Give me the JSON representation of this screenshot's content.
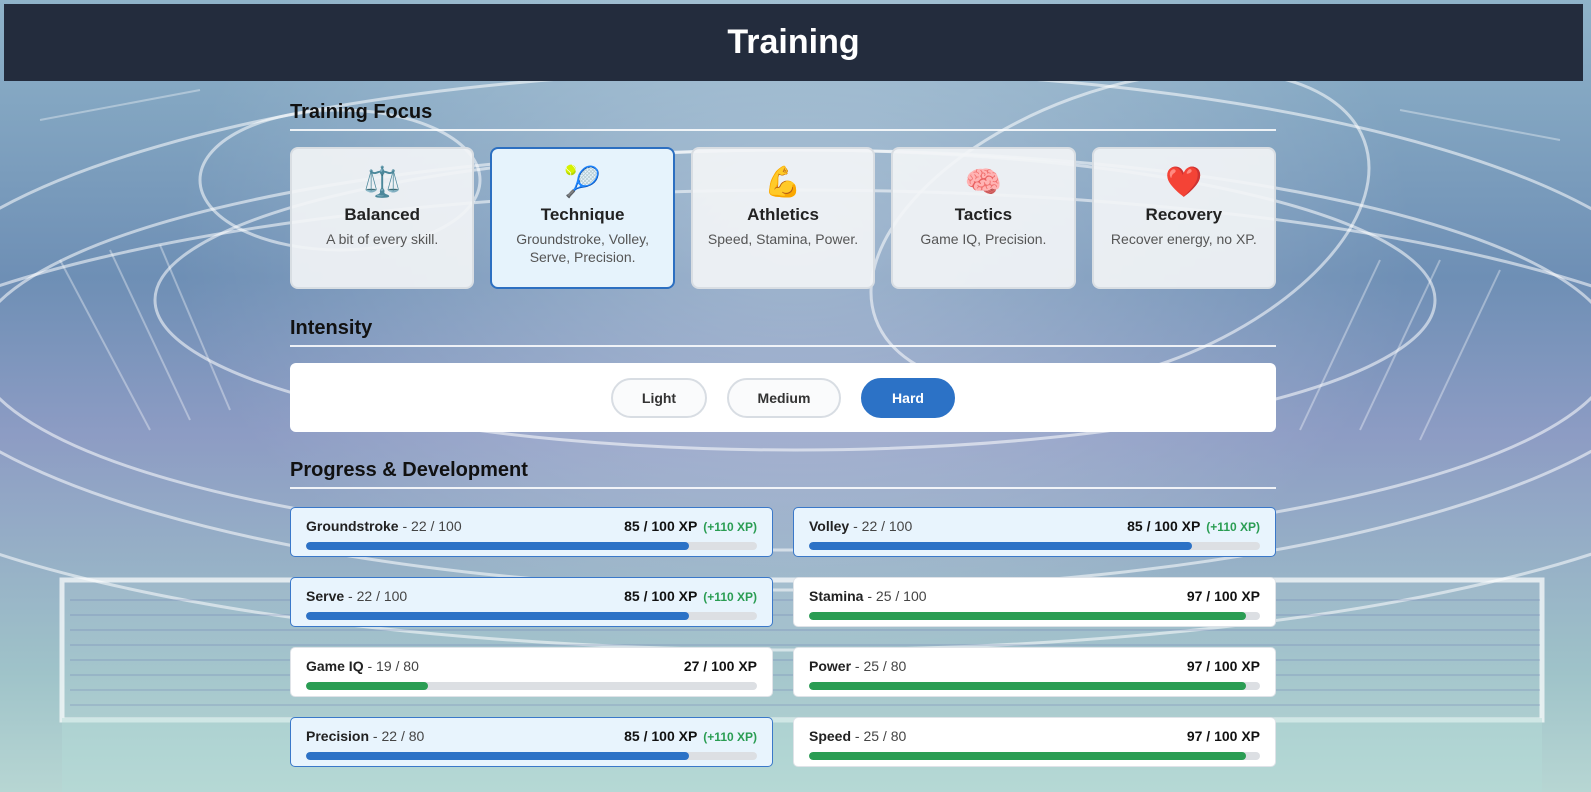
{
  "header": {
    "title": "Training"
  },
  "focus": {
    "title": "Training Focus",
    "cards": [
      {
        "icon": "⚖️",
        "icon_name": "scales-icon",
        "name": "Balanced",
        "desc": "A bit of every skill.",
        "selected": false
      },
      {
        "icon": "🎾",
        "icon_name": "tennis-ball-icon",
        "name": "Technique",
        "desc": "Groundstroke, Volley, Serve, Precision.",
        "selected": true
      },
      {
        "icon": "💪",
        "icon_name": "flexed-bicep-icon",
        "name": "Athletics",
        "desc": "Speed, Stamina, Power.",
        "selected": false
      },
      {
        "icon": "🧠",
        "icon_name": "brain-icon",
        "name": "Tactics",
        "desc": "Game IQ, Precision.",
        "selected": false
      },
      {
        "icon": "❤️",
        "icon_name": "heart-icon",
        "name": "Recovery",
        "desc": "Recover energy, no XP.",
        "selected": false
      }
    ]
  },
  "intensity": {
    "title": "Intensity",
    "options": [
      "Light",
      "Medium",
      "Hard"
    ],
    "selected": "Hard"
  },
  "progress": {
    "title": "Progress & Development",
    "stats": [
      {
        "name": "Groundstroke",
        "level": "22 / 100",
        "xp": "85 / 100 XP",
        "gain": "(+110 XP)",
        "fill": 0.85,
        "color": "blue",
        "boosted": true
      },
      {
        "name": "Volley",
        "level": "22 / 100",
        "xp": "85 / 100 XP",
        "gain": "(+110 XP)",
        "fill": 0.85,
        "color": "blue",
        "boosted": true
      },
      {
        "name": "Serve",
        "level": "22 / 100",
        "xp": "85 / 100 XP",
        "gain": "(+110 XP)",
        "fill": 0.85,
        "color": "blue",
        "boosted": true
      },
      {
        "name": "Stamina",
        "level": "25 / 100",
        "xp": "97 / 100 XP",
        "gain": "",
        "fill": 0.97,
        "color": "green",
        "boosted": false
      },
      {
        "name": "Game IQ",
        "level": "19 / 80",
        "xp": "27 / 100 XP",
        "gain": "",
        "fill": 0.27,
        "color": "green",
        "boosted": false
      },
      {
        "name": "Power",
        "level": "25 / 80",
        "xp": "97 / 100 XP",
        "gain": "",
        "fill": 0.97,
        "color": "green",
        "boosted": false
      },
      {
        "name": "Precision",
        "level": "22 / 80",
        "xp": "85 / 100 XP",
        "gain": "(+110 XP)",
        "fill": 0.85,
        "color": "blue",
        "boosted": true
      },
      {
        "name": "Speed",
        "level": "25 / 80",
        "xp": "97 / 100 XP",
        "gain": "",
        "fill": 0.97,
        "color": "green",
        "boosted": false
      }
    ]
  },
  "colors": {
    "header_bg": "#232c3d",
    "accent_blue": "#2c72c6",
    "accent_green": "#2a9d53",
    "selected_border": "#2c6fc1"
  }
}
